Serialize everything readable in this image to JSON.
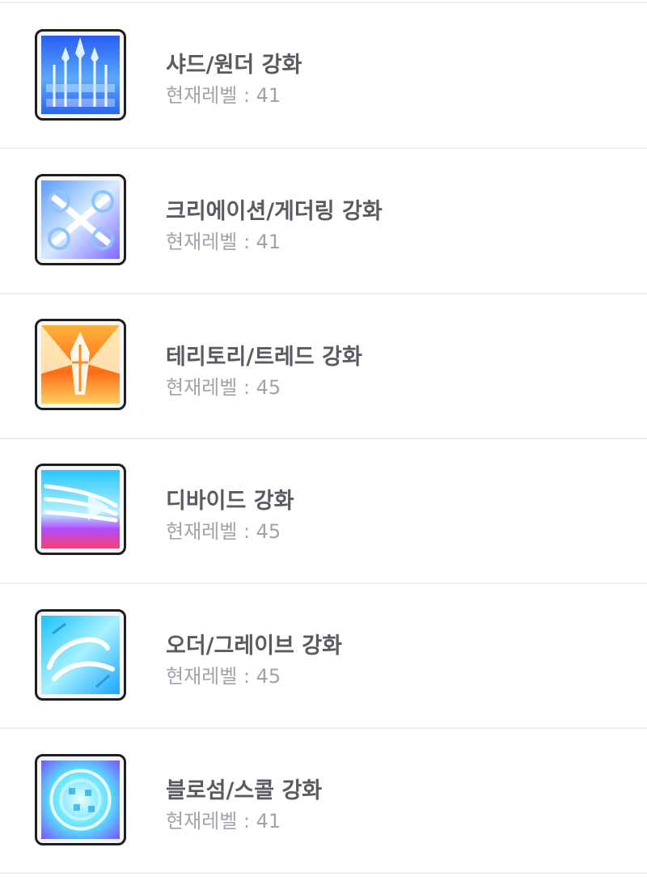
{
  "skills": [
    {
      "name": "샤드/원더 강화",
      "level_label": "현재레벨 : 41",
      "icon": "shard-wonder-skill-icon",
      "colors": [
        "#2f6dff",
        "#bfe3ff",
        "#ffffff"
      ]
    },
    {
      "name": "크리에이션/게더링 강화",
      "level_label": "현재레벨 : 41",
      "icon": "creation-gathering-skill-icon",
      "colors": [
        "#6aa8ff",
        "#e9f3ff",
        "#a77bff"
      ]
    },
    {
      "name": "테리토리/트레드 강화",
      "level_label": "현재레벨 : 45",
      "icon": "territory-tread-skill-icon",
      "colors": [
        "#ff7a1a",
        "#ffd76b",
        "#ffffff"
      ]
    },
    {
      "name": "디바이드 강화",
      "level_label": "현재레벨 : 45",
      "icon": "divide-skill-icon",
      "colors": [
        "#37c8ff",
        "#c64bff",
        "#ff4b8a"
      ]
    },
    {
      "name": "오더/그레이브 강화",
      "level_label": "현재레벨 : 45",
      "icon": "order-grave-skill-icon",
      "colors": [
        "#2fd2ff",
        "#b7f3ff",
        "#ffffff"
      ]
    },
    {
      "name": "블로섬/스콜 강화",
      "level_label": "현재레벨 : 41",
      "icon": "blossom-scool-skill-icon",
      "colors": [
        "#4fdfff",
        "#8a6bff",
        "#e8fbff"
      ]
    }
  ]
}
